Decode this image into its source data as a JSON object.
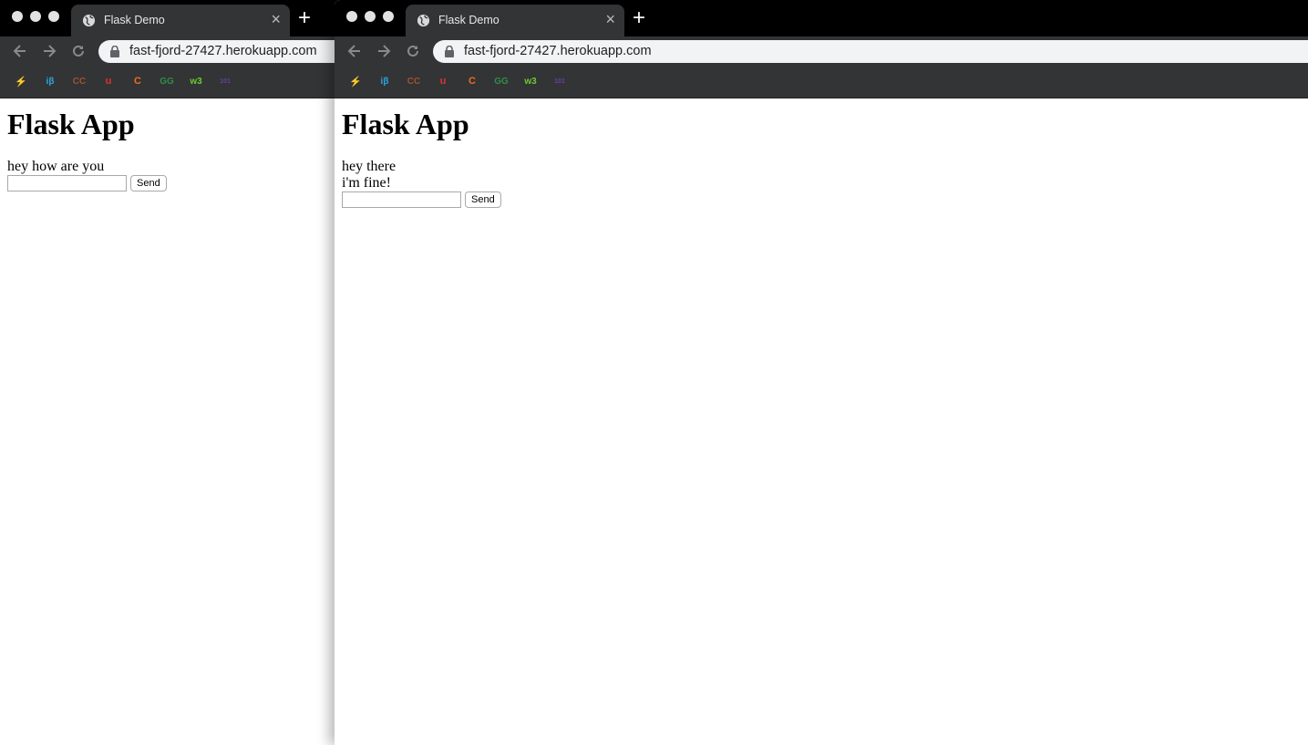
{
  "windows": [
    {
      "tab_title": "Flask Demo",
      "url": "fast-fjord-27427.herokuapp.com",
      "page_title": "Flask App",
      "messages": [
        "hey how are you"
      ],
      "input_value": "",
      "send_label": "Send"
    },
    {
      "tab_title": "Flask Demo",
      "url": "fast-fjord-27427.herokuapp.com",
      "page_title": "Flask App",
      "messages": [
        "hey there",
        "i'm fine!"
      ],
      "input_value": "",
      "send_label": "Send"
    }
  ],
  "bookmarks": [
    {
      "icon": "lightning-bookmark-icon",
      "glyph": "⚡",
      "color": "#f5a623"
    },
    {
      "icon": "ib-bookmark-icon",
      "glyph": "iβ",
      "color": "#29a8e0"
    },
    {
      "icon": "cc-bookmark-icon",
      "glyph": "CC",
      "color": "#a0522d"
    },
    {
      "icon": "udemy-bookmark-icon",
      "glyph": "u",
      "color": "#e0312f"
    },
    {
      "icon": "c-bookmark-icon",
      "glyph": "C",
      "color": "#f26b21"
    },
    {
      "icon": "gfg-bookmark-icon",
      "glyph": "GG",
      "color": "#2f8d46"
    },
    {
      "icon": "w3-bookmark-icon",
      "glyph": "w3",
      "color": "#6acc2d"
    },
    {
      "icon": "101-bookmark-icon",
      "glyph": "101",
      "color": "#6b3fa0"
    }
  ]
}
